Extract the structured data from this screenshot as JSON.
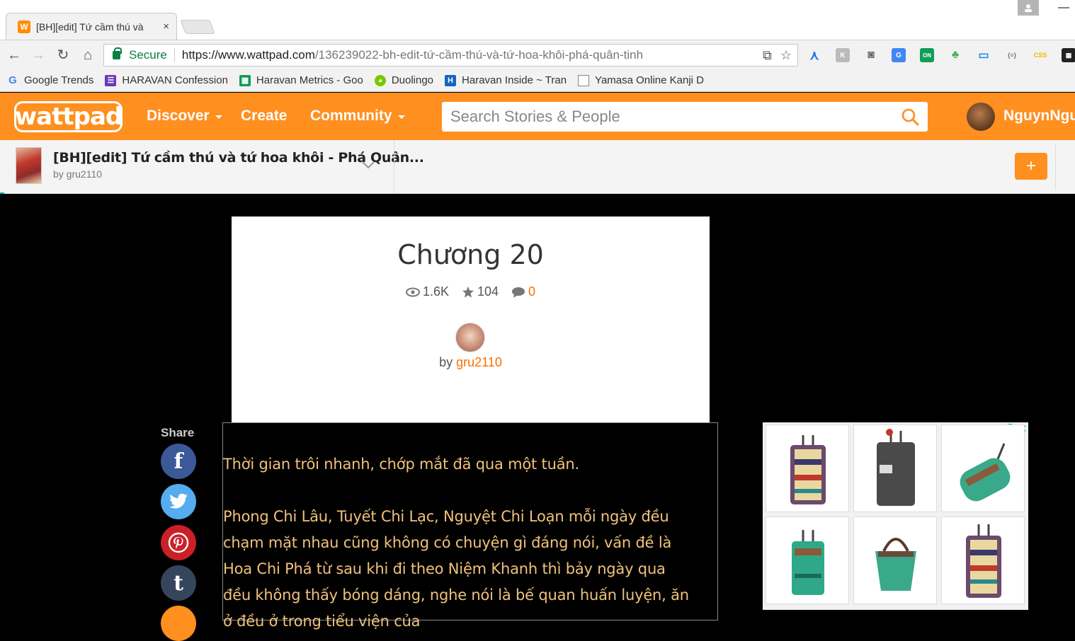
{
  "browser": {
    "tab_title": "[BH][edit] Tứ cầm thú và",
    "tab_close": "×",
    "secure_label": "Secure",
    "url_host": "https://www.wattpad.com",
    "url_path": "/136239022-bh-edit-tứ-cầm-thú-và-tứ-hoa-khôi-phá-quân-tinh"
  },
  "bookmarks": [
    {
      "label": "Google Trends",
      "icon": "google-icon",
      "color": "#4285f4"
    },
    {
      "label": "HARAVAN Confession",
      "icon": "form-icon",
      "color": "#673ab7"
    },
    {
      "label": "Haravan Metrics - Goo",
      "icon": "sheet-icon",
      "color": "#0f9d58"
    },
    {
      "label": "Duolingo",
      "icon": "duolingo-icon",
      "color": "#78c800"
    },
    {
      "label": "Haravan Inside ~ Tran",
      "icon": "haravan-icon",
      "color": "#1565c0"
    },
    {
      "label": "Yamasa Online Kanji D",
      "icon": "page-icon",
      "color": "#ffffff"
    }
  ],
  "header": {
    "logo": "wattpad",
    "nav": {
      "discover": "Discover",
      "create": "Create",
      "community": "Community"
    },
    "search_placeholder": "Search Stories & People",
    "username": "NguynNgu"
  },
  "story": {
    "title": "[BH][edit] Tứ cầm thú và tứ hoa khôi - Phá Quân...",
    "author": "by gru2110",
    "add_label": "+"
  },
  "chapter": {
    "title": "Chương 20",
    "views": "1.6K",
    "votes": "104",
    "comments": "0",
    "by": "by ",
    "author": "gru2110"
  },
  "share": {
    "label": "Share",
    "buttons": [
      {
        "name": "facebook",
        "glyph": "f",
        "color": "#3b5998"
      },
      {
        "name": "twitter",
        "glyph": "🐦",
        "color": "#55acee"
      },
      {
        "name": "pinterest",
        "glyph": "P",
        "color": "#cb2027"
      },
      {
        "name": "tumblr",
        "glyph": "t",
        "color": "#35465c"
      }
    ]
  },
  "content": {
    "p1": "Thời gian trôi nhanh, chớp mắt đã qua một tuần.",
    "p2": "Phong Chi Lâu, Tuyết Chi Lạc, Nguyệt Chi Loạn mỗi ngày đều chạm mặt nhau cũng không có chuyện gì đáng nói, vấn đề là Hoa Chi Phá từ sau khi đi theo Niệm Khanh thì bảy ngày qua đều không thấy bóng dáng, nghe nói là bế quan huấn luyện, ăn ở đều ở trong tiểu viện của"
  },
  "ad": {
    "info": "i",
    "close": "✕"
  }
}
